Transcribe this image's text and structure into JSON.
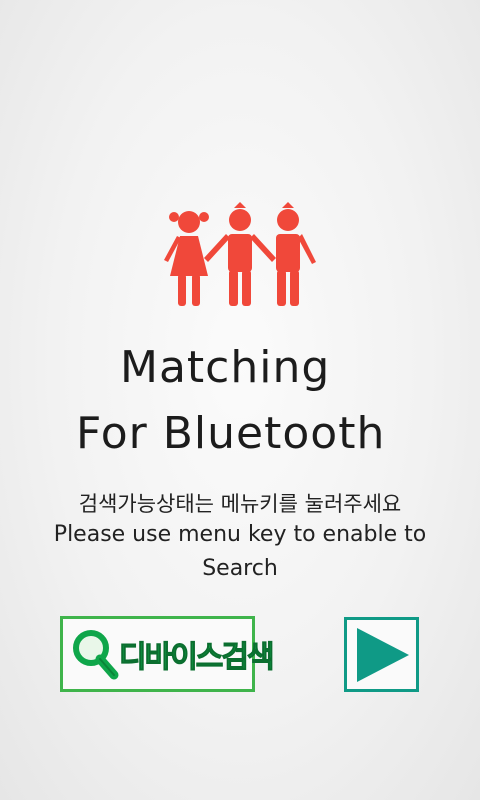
{
  "title": {
    "line1": "Matching",
    "line2": "For Bluetooth"
  },
  "instructions": {
    "korean": "검색가능상태는 메뉴키를 눌러주세요",
    "english_line1": "Please use menu key to enable to",
    "english_line2": "Search"
  },
  "buttons": {
    "device_search_label": "디바이스검색"
  },
  "colors": {
    "logo": "#f0483a",
    "search_border": "#3fb44b",
    "search_text": "#0fa64a",
    "play": "#0f9a86"
  },
  "icons": {
    "logo": "three-children-icon",
    "search": "magnifier-icon",
    "play": "play-icon"
  }
}
